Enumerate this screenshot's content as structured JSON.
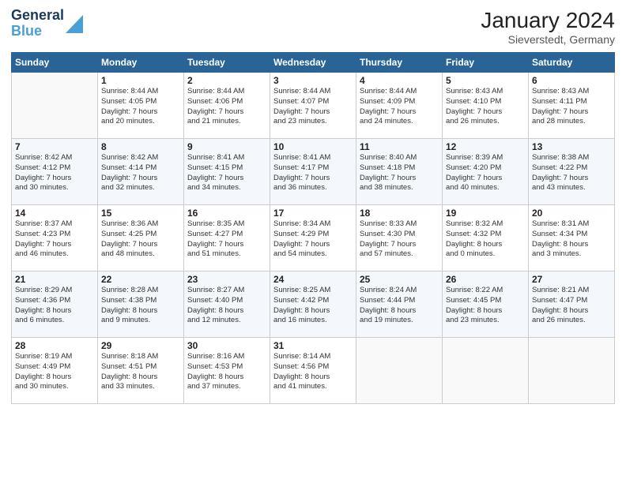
{
  "header": {
    "logo_line1": "General",
    "logo_line2": "Blue",
    "month": "January 2024",
    "location": "Sieverstedt, Germany"
  },
  "days_of_week": [
    "Sunday",
    "Monday",
    "Tuesday",
    "Wednesday",
    "Thursday",
    "Friday",
    "Saturday"
  ],
  "weeks": [
    [
      {
        "day": "",
        "sunrise": "",
        "sunset": "",
        "daylight": ""
      },
      {
        "day": "1",
        "sunrise": "Sunrise: 8:44 AM",
        "sunset": "Sunset: 4:05 PM",
        "daylight": "Daylight: 7 hours and 20 minutes."
      },
      {
        "day": "2",
        "sunrise": "Sunrise: 8:44 AM",
        "sunset": "Sunset: 4:06 PM",
        "daylight": "Daylight: 7 hours and 21 minutes."
      },
      {
        "day": "3",
        "sunrise": "Sunrise: 8:44 AM",
        "sunset": "Sunset: 4:07 PM",
        "daylight": "Daylight: 7 hours and 23 minutes."
      },
      {
        "day": "4",
        "sunrise": "Sunrise: 8:44 AM",
        "sunset": "Sunset: 4:09 PM",
        "daylight": "Daylight: 7 hours and 24 minutes."
      },
      {
        "day": "5",
        "sunrise": "Sunrise: 8:43 AM",
        "sunset": "Sunset: 4:10 PM",
        "daylight": "Daylight: 7 hours and 26 minutes."
      },
      {
        "day": "6",
        "sunrise": "Sunrise: 8:43 AM",
        "sunset": "Sunset: 4:11 PM",
        "daylight": "Daylight: 7 hours and 28 minutes."
      }
    ],
    [
      {
        "day": "7",
        "sunrise": "Sunrise: 8:42 AM",
        "sunset": "Sunset: 4:12 PM",
        "daylight": "Daylight: 7 hours and 30 minutes."
      },
      {
        "day": "8",
        "sunrise": "Sunrise: 8:42 AM",
        "sunset": "Sunset: 4:14 PM",
        "daylight": "Daylight: 7 hours and 32 minutes."
      },
      {
        "day": "9",
        "sunrise": "Sunrise: 8:41 AM",
        "sunset": "Sunset: 4:15 PM",
        "daylight": "Daylight: 7 hours and 34 minutes."
      },
      {
        "day": "10",
        "sunrise": "Sunrise: 8:41 AM",
        "sunset": "Sunset: 4:17 PM",
        "daylight": "Daylight: 7 hours and 36 minutes."
      },
      {
        "day": "11",
        "sunrise": "Sunrise: 8:40 AM",
        "sunset": "Sunset: 4:18 PM",
        "daylight": "Daylight: 7 hours and 38 minutes."
      },
      {
        "day": "12",
        "sunrise": "Sunrise: 8:39 AM",
        "sunset": "Sunset: 4:20 PM",
        "daylight": "Daylight: 7 hours and 40 minutes."
      },
      {
        "day": "13",
        "sunrise": "Sunrise: 8:38 AM",
        "sunset": "Sunset: 4:22 PM",
        "daylight": "Daylight: 7 hours and 43 minutes."
      }
    ],
    [
      {
        "day": "14",
        "sunrise": "Sunrise: 8:37 AM",
        "sunset": "Sunset: 4:23 PM",
        "daylight": "Daylight: 7 hours and 46 minutes."
      },
      {
        "day": "15",
        "sunrise": "Sunrise: 8:36 AM",
        "sunset": "Sunset: 4:25 PM",
        "daylight": "Daylight: 7 hours and 48 minutes."
      },
      {
        "day": "16",
        "sunrise": "Sunrise: 8:35 AM",
        "sunset": "Sunset: 4:27 PM",
        "daylight": "Daylight: 7 hours and 51 minutes."
      },
      {
        "day": "17",
        "sunrise": "Sunrise: 8:34 AM",
        "sunset": "Sunset: 4:29 PM",
        "daylight": "Daylight: 7 hours and 54 minutes."
      },
      {
        "day": "18",
        "sunrise": "Sunrise: 8:33 AM",
        "sunset": "Sunset: 4:30 PM",
        "daylight": "Daylight: 7 hours and 57 minutes."
      },
      {
        "day": "19",
        "sunrise": "Sunrise: 8:32 AM",
        "sunset": "Sunset: 4:32 PM",
        "daylight": "Daylight: 8 hours and 0 minutes."
      },
      {
        "day": "20",
        "sunrise": "Sunrise: 8:31 AM",
        "sunset": "Sunset: 4:34 PM",
        "daylight": "Daylight: 8 hours and 3 minutes."
      }
    ],
    [
      {
        "day": "21",
        "sunrise": "Sunrise: 8:29 AM",
        "sunset": "Sunset: 4:36 PM",
        "daylight": "Daylight: 8 hours and 6 minutes."
      },
      {
        "day": "22",
        "sunrise": "Sunrise: 8:28 AM",
        "sunset": "Sunset: 4:38 PM",
        "daylight": "Daylight: 8 hours and 9 minutes."
      },
      {
        "day": "23",
        "sunrise": "Sunrise: 8:27 AM",
        "sunset": "Sunset: 4:40 PM",
        "daylight": "Daylight: 8 hours and 12 minutes."
      },
      {
        "day": "24",
        "sunrise": "Sunrise: 8:25 AM",
        "sunset": "Sunset: 4:42 PM",
        "daylight": "Daylight: 8 hours and 16 minutes."
      },
      {
        "day": "25",
        "sunrise": "Sunrise: 8:24 AM",
        "sunset": "Sunset: 4:44 PM",
        "daylight": "Daylight: 8 hours and 19 minutes."
      },
      {
        "day": "26",
        "sunrise": "Sunrise: 8:22 AM",
        "sunset": "Sunset: 4:45 PM",
        "daylight": "Daylight: 8 hours and 23 minutes."
      },
      {
        "day": "27",
        "sunrise": "Sunrise: 8:21 AM",
        "sunset": "Sunset: 4:47 PM",
        "daylight": "Daylight: 8 hours and 26 minutes."
      }
    ],
    [
      {
        "day": "28",
        "sunrise": "Sunrise: 8:19 AM",
        "sunset": "Sunset: 4:49 PM",
        "daylight": "Daylight: 8 hours and 30 minutes."
      },
      {
        "day": "29",
        "sunrise": "Sunrise: 8:18 AM",
        "sunset": "Sunset: 4:51 PM",
        "daylight": "Daylight: 8 hours and 33 minutes."
      },
      {
        "day": "30",
        "sunrise": "Sunrise: 8:16 AM",
        "sunset": "Sunset: 4:53 PM",
        "daylight": "Daylight: 8 hours and 37 minutes."
      },
      {
        "day": "31",
        "sunrise": "Sunrise: 8:14 AM",
        "sunset": "Sunset: 4:56 PM",
        "daylight": "Daylight: 8 hours and 41 minutes."
      },
      {
        "day": "",
        "sunrise": "",
        "sunset": "",
        "daylight": ""
      },
      {
        "day": "",
        "sunrise": "",
        "sunset": "",
        "daylight": ""
      },
      {
        "day": "",
        "sunrise": "",
        "sunset": "",
        "daylight": ""
      }
    ]
  ]
}
